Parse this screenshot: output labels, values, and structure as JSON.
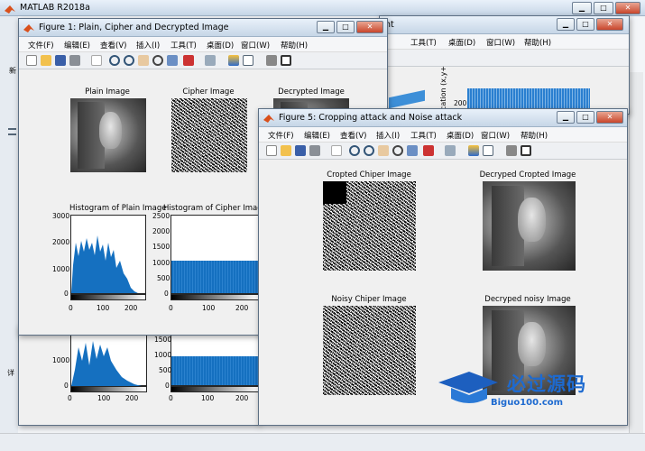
{
  "main": {
    "title": "MATLAB R2018a",
    "side_chars": [
      "新",
      "详"
    ]
  },
  "bg_plot": {
    "axis_label": "cation (x,y+",
    "tick": "200"
  },
  "fig1": {
    "title": "Figure 1: Plain, Cipher and Decrypted Image",
    "menu": [
      "文件(F)",
      "编辑(E)",
      "查看(V)",
      "插入(I)",
      "工具(T)",
      "桌面(D)",
      "窗口(W)",
      "帮助(H)"
    ],
    "plain_title": "Plain Image",
    "cipher_title": "Cipher Image",
    "decrypted_title": "Decrypted Image",
    "hist_plain_title": "Histogram of Plain Image",
    "hist_cipher_title": "Histogram of Cipher Image",
    "plain_yticks": [
      "3000",
      "2000",
      "1000",
      "0"
    ],
    "cipher_yticks": [
      "2500",
      "2000",
      "1500",
      "1000",
      "500",
      "0"
    ],
    "xticks": [
      "0",
      "100",
      "200"
    ]
  },
  "fig0": {
    "yticks_plain": [
      "1000",
      "0"
    ],
    "yticks_cipher": [
      "1500",
      "1000",
      "500",
      "0"
    ],
    "xticks": [
      "0",
      "100",
      "200"
    ],
    "title_fragment": "nt"
  },
  "fig5": {
    "title": "Figure 5: Cropping attack and Noise attack",
    "menu": [
      "文件(F)",
      "编辑(E)",
      "查看(V)",
      "插入(I)",
      "工具(T)",
      "桌面(D)",
      "窗口(W)",
      "帮助(H)"
    ],
    "cropped_cipher_title": "Cropted Chiper Image",
    "decrypted_cropped_title": "Decryped Cropted Image",
    "noisy_cipher_title": "Noisy Chiper Image",
    "decrypted_noisy_title": "Decryped noisy Image"
  },
  "watermark": {
    "name": "必过源码",
    "url": "Biguo100.com"
  },
  "colors": {
    "hist": "#1570c0",
    "titlebar_top": "#e9f1fa",
    "titlebar_bottom": "#c6d6e7"
  }
}
